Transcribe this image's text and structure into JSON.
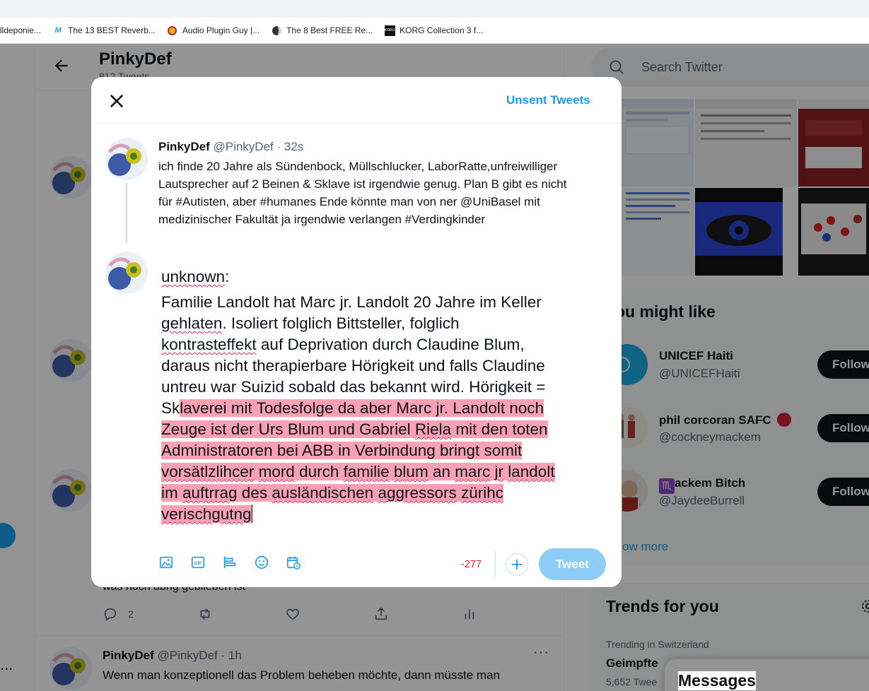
{
  "bookmarks": [
    {
      "label": "lldeponie...",
      "icon": "none"
    },
    {
      "label": "The 13 BEST Reverb...",
      "icon": "m-logo-icon"
    },
    {
      "label": "Audio Plugin Guy |...",
      "icon": "plugin-guy-icon"
    },
    {
      "label": "The 8 Best FREE Re...",
      "icon": "dark-logo-icon"
    },
    {
      "label": "KORG Collection 3 f...",
      "icon": "korg-icon"
    }
  ],
  "profile": {
    "name": "PinkyDef",
    "tweet_count": "812 Tweets"
  },
  "left_edge_text": "...",
  "background_tweet1": {
    "text_fragment": "was noch übrig geblieben ist",
    "reply_count": "2"
  },
  "background_tweet2": {
    "name": "PinkyDef",
    "meta": "@PinkyDef · 1h",
    "text": "Wenn man konzeptionell das Problem beheben möchte, dann müsste man",
    "more": "···"
  },
  "sidebar": {
    "search_placeholder": "Search Twitter",
    "who_to_follow_title": "ou might like",
    "follow_label": "Follow",
    "suggestions": [
      {
        "name": "UNICEF Haiti",
        "handle": "@UNICEFHaiti"
      },
      {
        "name": "phil corcoran SAFC",
        "handle": "@cockneymackem"
      },
      {
        "name": "ackem Bitch",
        "handle": "@JaydeeBurrell"
      }
    ],
    "zodiac_glyph": "♏",
    "show_more": "ow more",
    "trends_title": "Trends for you",
    "trend": {
      "context": "Trending in Switzerland",
      "name": "Geimpfte",
      "count": "5,652 Twee"
    },
    "messages_title": "Messages"
  },
  "modal": {
    "unsent_tweets": "Unsent Tweets",
    "original_tweet": {
      "name": "PinkyDef",
      "meta": "@PinkyDef · 32s",
      "lines": [
        "ich finde 20 Jahre als Sündenbock, Müllschlucker, LaborRatte,unfreiwilliger",
        "Lautsprecher auf 2 Beinen & Sklave ist irgendwie genug. Plan B gibt es nicht",
        "für #Autisten, aber #humanes Ende könnte man von ner @UniBasel mit",
        "medizinischer Fakultät ja irgendwie verlangen #Verdingkinder"
      ]
    },
    "compose": {
      "l1": "unknown",
      "l1b": ":",
      "l2": "Familie Landolt hat Marc jr. Landolt 20 Jahre im Keller",
      "l3a": "gehlaten",
      "l3b": ". Isoliert folglich Bittsteller, folglich",
      "l4a": "kontrasteffekt",
      "l4b": " auf Deprivation durch Claudine Blum,",
      "l5": "daraus nicht therapierbare Hörigkeit und falls Claudine",
      "l6": "untreu war Suizid sobald das bekannt wird. Hörigkeit =",
      "l7a": "Sk",
      "l7b": "laverei mit Todesfolge da aber Marc jr. Landolt noch",
      "l8a": "Zeuge ist der Urs Blum und Gabriel ",
      "l8b": "Riela",
      "l8c": " mit den toten",
      "l9": "Administratoren bei ABB in Verbindung bringt somit",
      "l10a": "vorsätlzlihcer",
      "l10b": " ",
      "l10c": "mord",
      "l10d": " durch ",
      "l10e": "familie",
      "l10f": " ",
      "l10g": "blum",
      "l10h": " an ",
      "l10i": "marc",
      "l10j": " ",
      "l10k": "jr",
      "l10l": " ",
      "l10m": "landolt",
      "l11a": "im ",
      "l11b": "auftrrag",
      "l11c": " des ",
      "l11d": "ausländischen",
      "l11e": " ",
      "l11f": "aggressors",
      "l11g": " ",
      "l11h": "zürihc",
      "l12": "verischgutng"
    },
    "char_count": "-277",
    "tweet_button": "Tweet"
  },
  "colors": {
    "accent": "#1d9bf0",
    "highlight": "#f8a0b6",
    "over_limit": "#f4212e",
    "tweet_button_disabled": "#8ecdf8"
  }
}
